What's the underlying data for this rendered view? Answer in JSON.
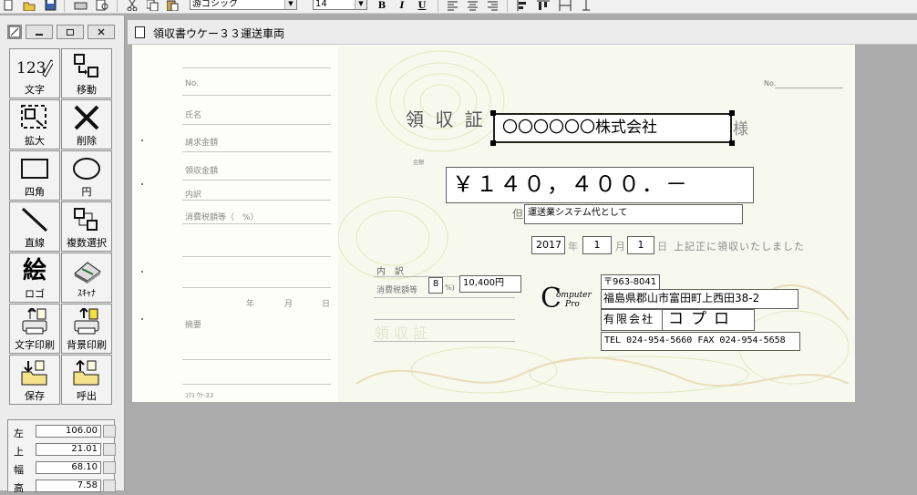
{
  "toolbar": {
    "font_name": "游ゴシック",
    "font_size": "14",
    "bold": "B",
    "italic": "I",
    "underline": "U"
  },
  "sidebar": {
    "tools": [
      {
        "id": "text",
        "label": "文字",
        "icon": "text-tool-icon"
      },
      {
        "id": "move",
        "label": "移動",
        "icon": "move-tool-icon"
      },
      {
        "id": "enlarge",
        "label": "拡大",
        "icon": "enlarge-tool-icon"
      },
      {
        "id": "delete",
        "label": "削除",
        "icon": "delete-x-icon"
      },
      {
        "id": "rect",
        "label": "四角",
        "icon": "rectangle-icon"
      },
      {
        "id": "circle",
        "label": "円",
        "icon": "circle-icon"
      },
      {
        "id": "line",
        "label": "直線",
        "icon": "line-icon"
      },
      {
        "id": "multiselect",
        "label": "複数選択",
        "icon": "multi-select-icon"
      },
      {
        "id": "logo",
        "label": "ロゴ",
        "icon": "logo-picture-icon"
      },
      {
        "id": "scanner",
        "label": "ｽｷｬﾅ",
        "icon": "scanner-icon"
      },
      {
        "id": "textprint",
        "label": "文字印刷",
        "icon": "printer-icon"
      },
      {
        "id": "bgprint",
        "label": "背景印刷",
        "icon": "printer-icon"
      },
      {
        "id": "save",
        "label": "保存",
        "icon": "save-folder-icon"
      },
      {
        "id": "load",
        "label": "呼出",
        "icon": "open-folder-icon"
      }
    ],
    "logo_glyph": "絵",
    "coords": [
      {
        "label": "左",
        "value": "106.00"
      },
      {
        "label": "上",
        "value": "21.01"
      },
      {
        "label": "幅",
        "value": "68.10"
      },
      {
        "label": "高",
        "value": "7.58"
      }
    ]
  },
  "document": {
    "title": "領収書ウケー３３運送車両"
  },
  "receipt": {
    "stub": {
      "no": "No.",
      "name": "氏名",
      "billed": "請求金額",
      "received": "領収金額",
      "breakdown": "内訳",
      "tax": "消費税額等（　%）",
      "year": "年",
      "month": "月",
      "day": "日",
      "memo": "摘要",
      "footer": "ｺｸﾖ ｳｹ-33"
    },
    "heading": "領 収 証",
    "addressee": "〇〇〇〇〇〇株式会社",
    "honorific": "様",
    "no": "No.",
    "kingaku": "金額",
    "amount": "￥１４０，４００．－",
    "tadashi_label": "但",
    "tadashi": "運送業システム代として",
    "year": "2017",
    "year_label": "年",
    "month": "1",
    "month_label": "月",
    "day": "1",
    "day_label": "日",
    "confirm": "上記正に領収いたしました",
    "breakdown_label": "内　訳",
    "tax_label": "消費税額等",
    "tax_rate": "8",
    "pct_label": "%)",
    "tax_amount": "10,400円",
    "logo_c": "C",
    "logo_top": "omputer",
    "logo_bottom": "Pro",
    "postal": "〒963-8041",
    "address": "福島県郡山市富田町上西田38-2",
    "company_prefix": "有限会社",
    "company_name": "コプロ",
    "telfax": "TEL 024-954-5660 FAX 024-954-5658"
  }
}
